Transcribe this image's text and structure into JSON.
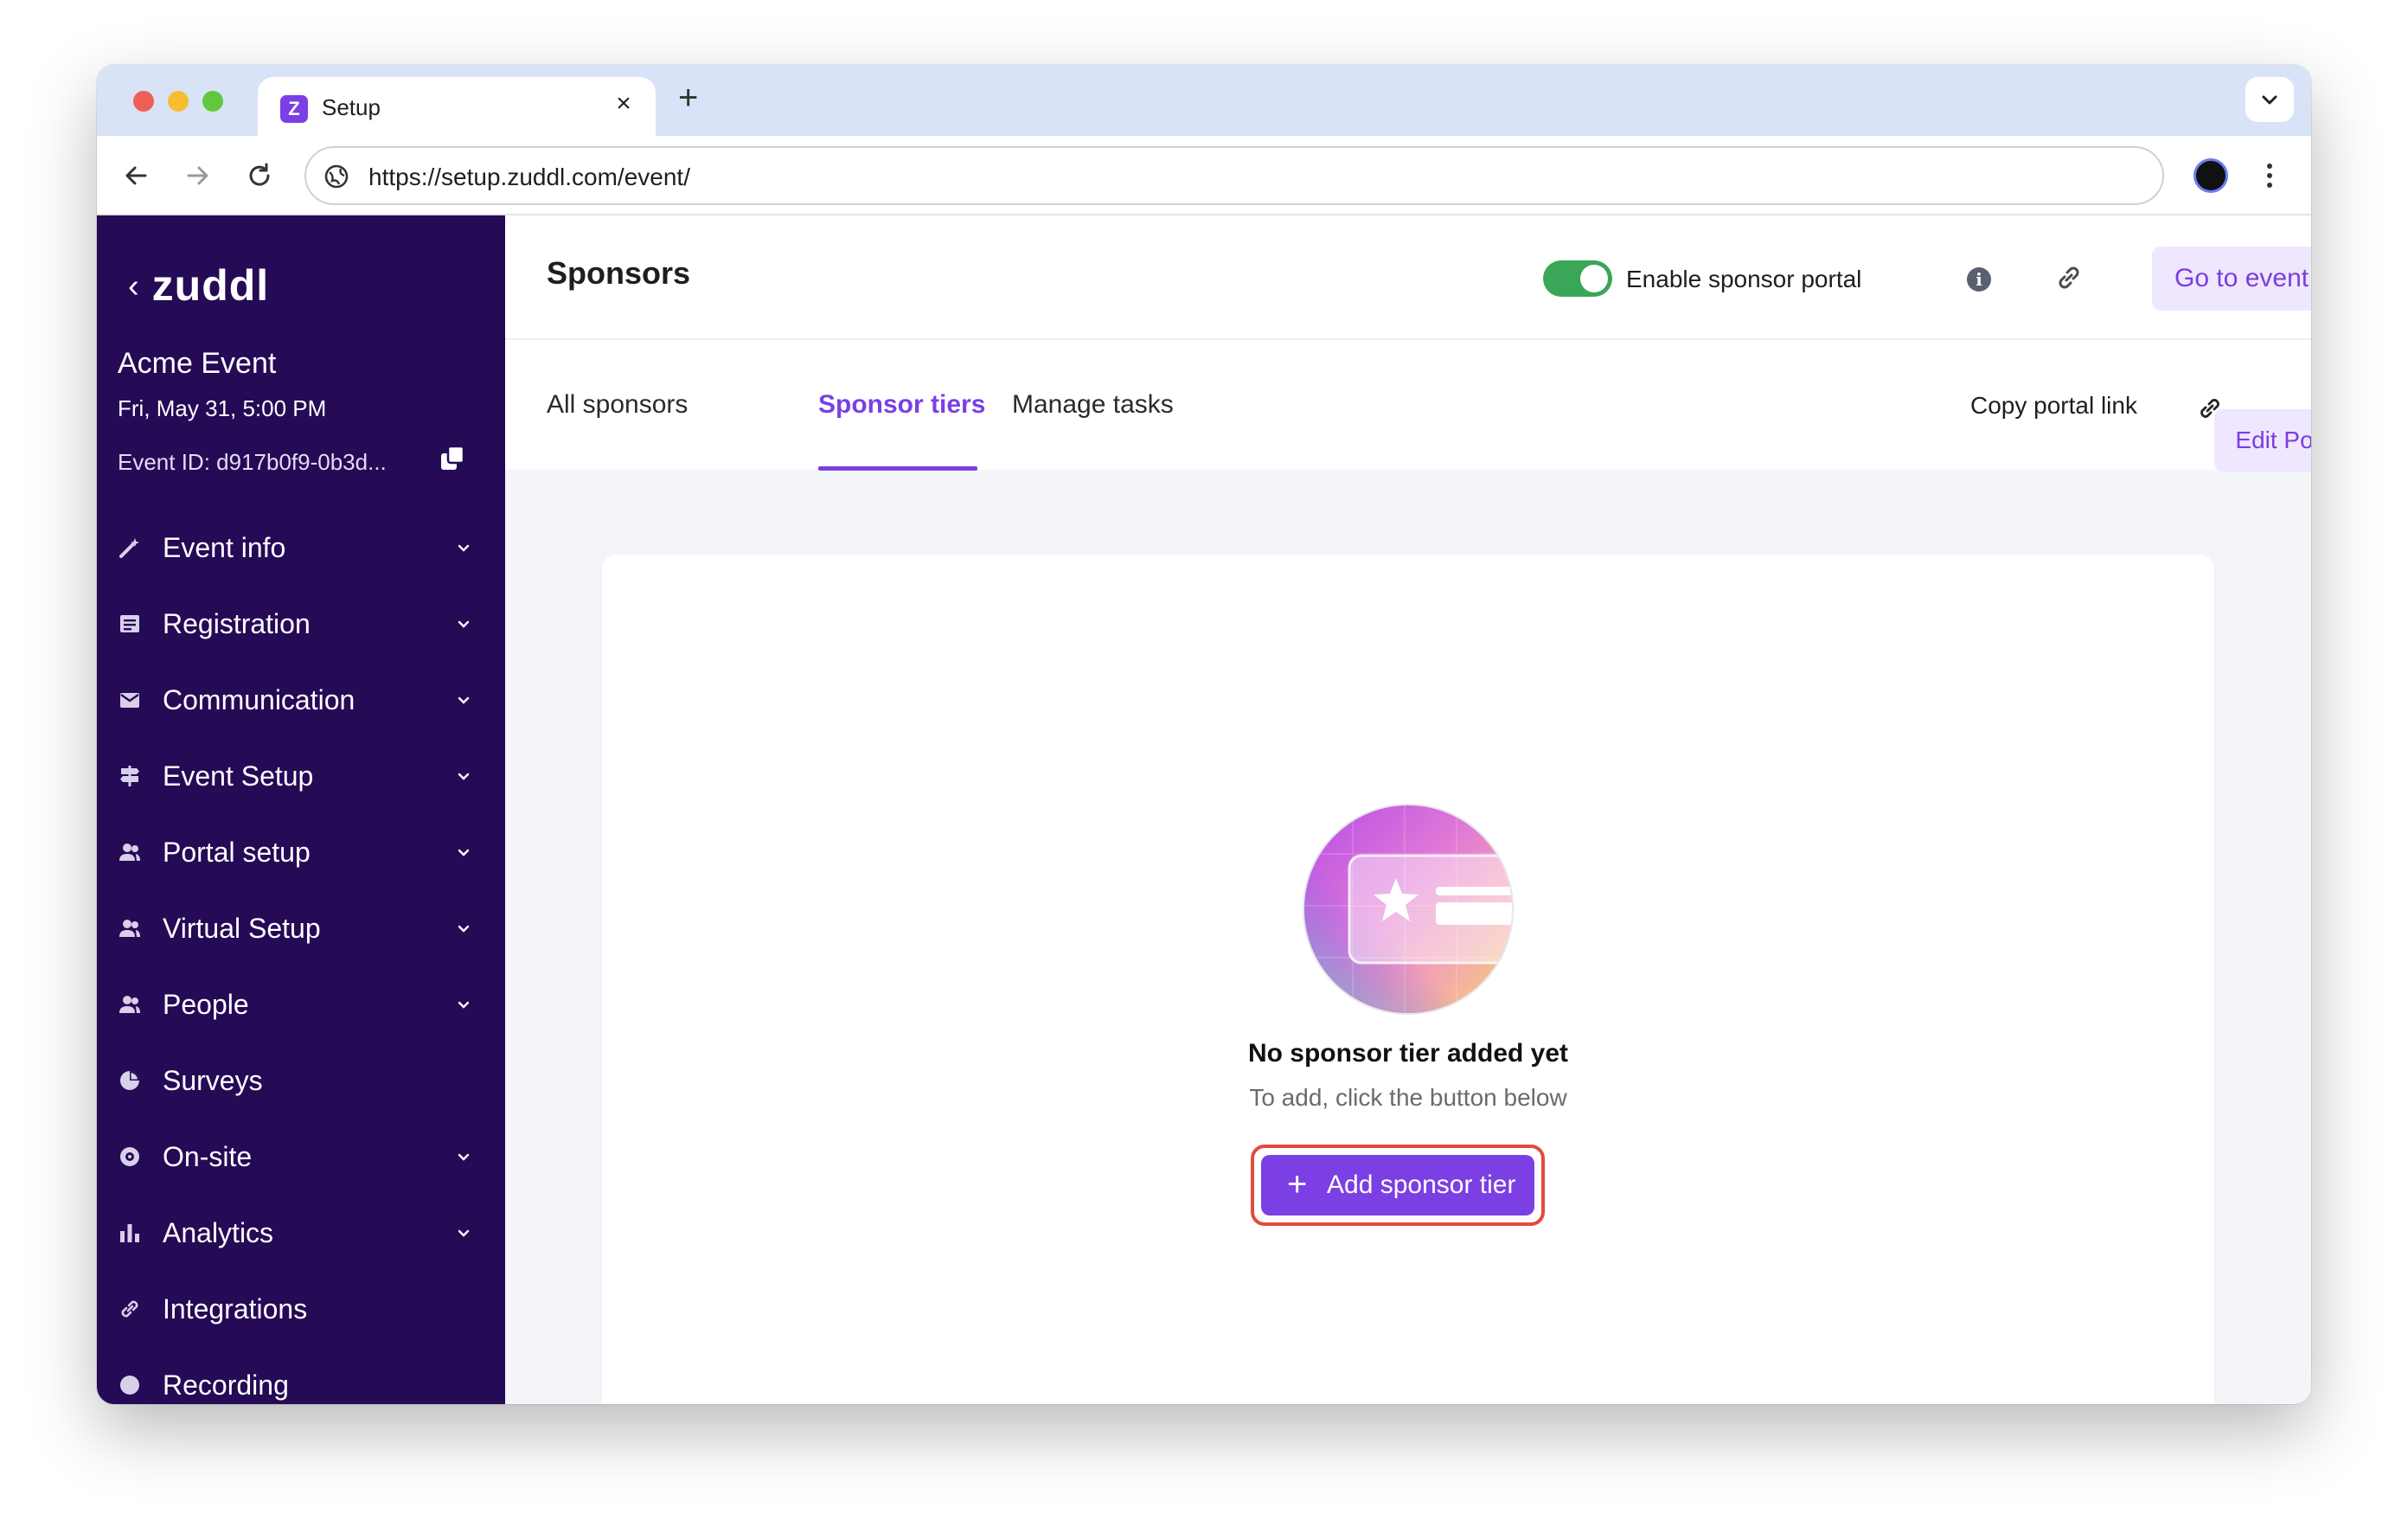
{
  "browser": {
    "tab_title": "Setup",
    "favicon_letter": "Z",
    "url": "https://setup.zuddl.com/event/"
  },
  "sidebar": {
    "logo": "zuddl",
    "event_name": "Acme Event",
    "event_date": "Fri, May 31, 5:00 PM",
    "event_id": "Event ID: d917b0f9-0b3d...",
    "items": [
      {
        "label": "Event info",
        "icon": "magic-wand-icon",
        "has_chevron": true
      },
      {
        "label": "Registration",
        "icon": "form-icon",
        "has_chevron": true
      },
      {
        "label": "Communication",
        "icon": "mail-icon",
        "has_chevron": true
      },
      {
        "label": "Event Setup",
        "icon": "signpost-icon",
        "has_chevron": true
      },
      {
        "label": "Portal setup",
        "icon": "people-icon",
        "has_chevron": true
      },
      {
        "label": "Virtual Setup",
        "icon": "people-icon",
        "has_chevron": true
      },
      {
        "label": "People",
        "icon": "people-icon",
        "has_chevron": true
      },
      {
        "label": "Surveys",
        "icon": "pie-chart-icon",
        "has_chevron": false
      },
      {
        "label": "On-site",
        "icon": "target-icon",
        "has_chevron": true
      },
      {
        "label": "Analytics",
        "icon": "bar-chart-icon",
        "has_chevron": true
      },
      {
        "label": "Integrations",
        "icon": "link-icon",
        "has_chevron": false
      },
      {
        "label": "Recording",
        "icon": "record-icon",
        "has_chevron": false
      }
    ]
  },
  "header": {
    "title": "Sponsors",
    "toggle_label": "Enable sponsor portal",
    "toggle_on": true,
    "go_to_event": "Go to event"
  },
  "tabs": {
    "items": [
      "All sponsors",
      "Sponsor tiers",
      "Manage tasks"
    ],
    "active": "Sponsor tiers",
    "copy_portal_link": "Copy portal link",
    "edit_portal": "Edit Portal"
  },
  "empty_state": {
    "title": "No sponsor tier added yet",
    "subtitle": "To add, click the button below",
    "button": "Add sponsor tier"
  },
  "colors": {
    "sidebar_bg": "#250a56",
    "accent": "#7b3fe4",
    "toggle_on": "#3aa657",
    "highlight_border": "#e24b3b"
  }
}
